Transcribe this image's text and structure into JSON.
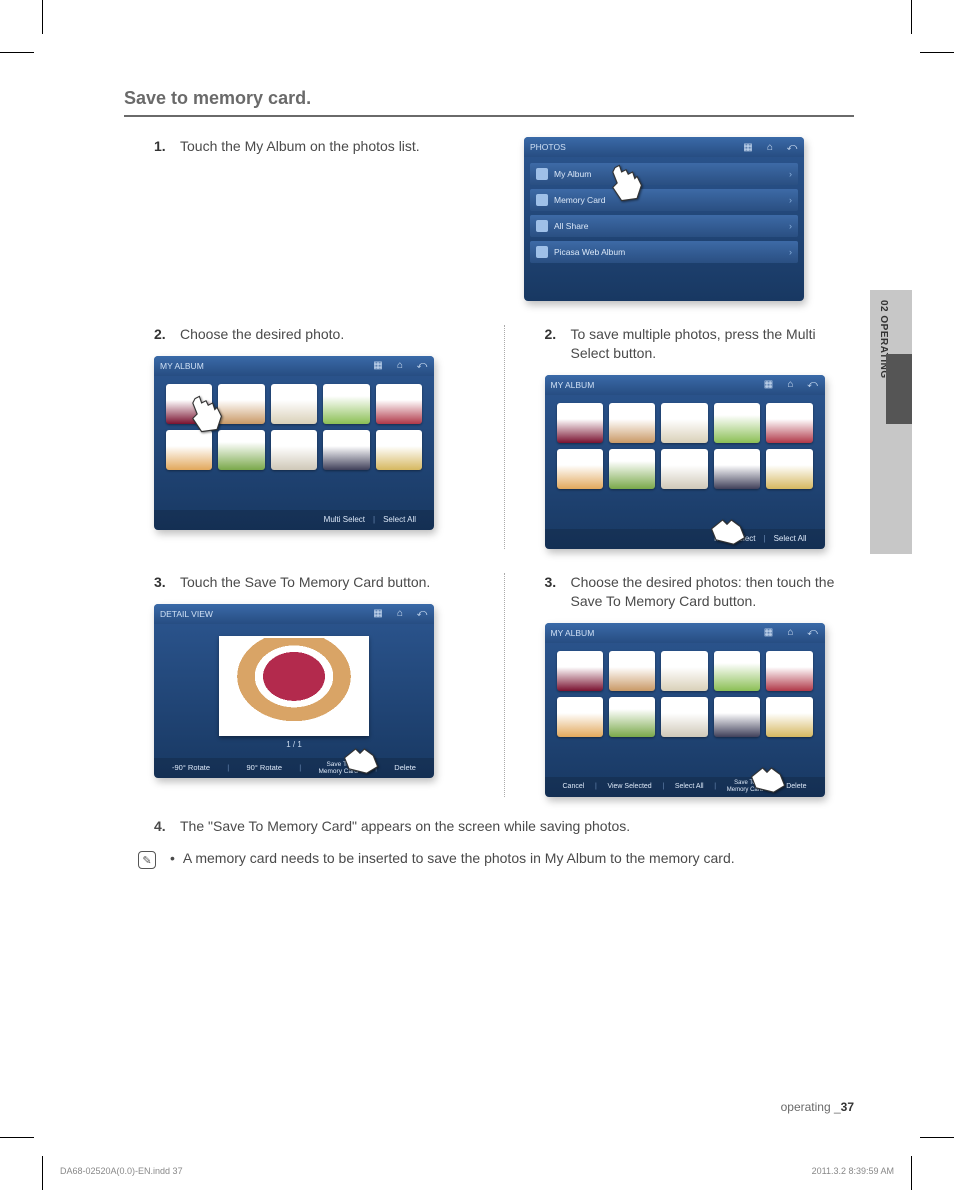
{
  "section_title": "Save to memory card.",
  "side_tab": {
    "label": "02  OPERATING"
  },
  "step1": {
    "num": "1.",
    "text": "Touch the My Album on the photos list."
  },
  "shot_photos": {
    "title": "PHOTOS",
    "items": [
      "My Album",
      "Memory Card",
      "All Share",
      "Picasa Web Album"
    ]
  },
  "left": {
    "s2": {
      "num": "2.",
      "text": "Choose the desired photo."
    },
    "s3": {
      "num": "3.",
      "text": "Touch the Save To Memory Card button."
    }
  },
  "right": {
    "s2": {
      "num": "2.",
      "text": "To save multiple photos, press the Multi Select button."
    },
    "s3": {
      "num": "3.",
      "text": "Choose the desired photos: then touch the Save To Memory Card button."
    }
  },
  "album": {
    "title": "MY ALBUM",
    "btn_multi": "Multi Select",
    "btn_selectall": "Select All"
  },
  "detail": {
    "title": "DETAIL VIEW",
    "pager": "1 / 1",
    "btn_rot_neg": "-90° Rotate",
    "btn_rot_pos": "90° Rotate",
    "btn_save": "Save To",
    "btn_save2": "Memory Card",
    "btn_delete": "Delete"
  },
  "album_select": {
    "title": "MY ALBUM",
    "btn_cancel": "Cancel",
    "btn_view": "View Selected",
    "btn_selectall": "Select All",
    "btn_save": "Save To",
    "btn_save2": "Memory Card",
    "btn_delete": "Delete"
  },
  "step4": {
    "num": "4.",
    "text": "The \"Save To Memory Card\" appears on the screen while saving photos."
  },
  "note": {
    "bullet": "•",
    "text": "A memory card needs to be inserted to save the photos in My Album to the memory card."
  },
  "footer": {
    "label": "operating _",
    "page": "37"
  },
  "printfoot": {
    "left": "DA68-02520A(0.0)-EN.indd   37",
    "right": "2011.3.2   8:39:59 AM"
  }
}
